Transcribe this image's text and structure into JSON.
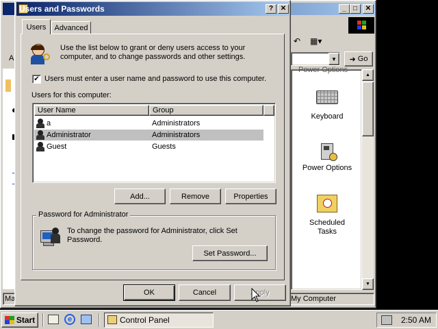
{
  "bg_window": {
    "address_go": "Go",
    "status_left": "Ma",
    "status_right": "My Computer",
    "header_partial": "Power Options",
    "icons": [
      {
        "label": "Keyboard",
        "icon": "keyboard-icon"
      },
      {
        "label": "Power Options",
        "icon": "power-options-icon"
      },
      {
        "label": "Scheduled\nTasks",
        "icon": "scheduled-tasks-icon"
      }
    ],
    "left_letter_a": "A"
  },
  "dialog": {
    "title": "Users and Passwords",
    "help_glyph": "?",
    "close_glyph": "✕",
    "tabs": [
      {
        "label": "Users",
        "active": true
      },
      {
        "label": "Advanced",
        "active": false
      }
    ],
    "intro_text": "Use the list below to grant or deny users access to your computer, and to change passwords and other settings.",
    "checkbox_label": "Users must enter a user name and password to use this computer.",
    "checkbox_checked": true,
    "users_label": "Users for this computer:",
    "columns": [
      "User Name",
      "Group"
    ],
    "users": [
      {
        "name": "a",
        "group": "Administrators",
        "selected": false
      },
      {
        "name": "Administrator",
        "group": "Administrators",
        "selected": true
      },
      {
        "name": "Guest",
        "group": "Guests",
        "selected": false
      }
    ],
    "buttons": {
      "add": "Add...",
      "remove": "Remove",
      "properties": "Properties"
    },
    "password_group_label": "Password for Administrator",
    "password_text": "To change the password for Administrator, click Set Password.",
    "set_password": "Set Password...",
    "ok": "OK",
    "cancel": "Cancel",
    "apply": "Apply"
  },
  "taskbar": {
    "start": "Start",
    "task": "Control Panel",
    "time": "2:50 AM"
  },
  "colors": {
    "titlebar_start": "#0a246a",
    "titlebar_end": "#a6caf0",
    "selection": "#c0c0c0",
    "desktop": "#000000"
  }
}
